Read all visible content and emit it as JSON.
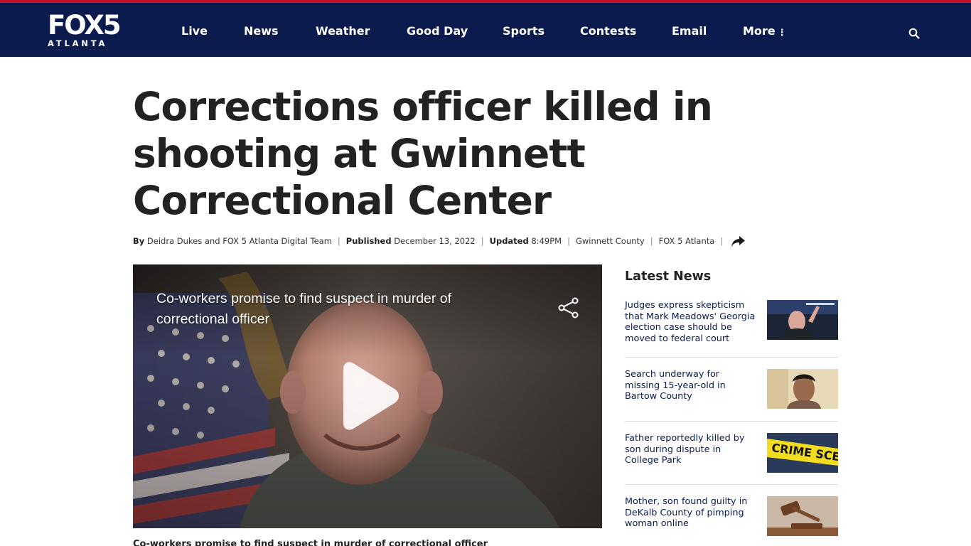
{
  "brand": {
    "logo_main": "FOX5",
    "logo_sub": "ATLANTA",
    "nav_bg": "#0b1b4d",
    "accent": "#c8102e"
  },
  "nav": {
    "items": [
      "Live",
      "News",
      "Weather",
      "Good Day",
      "Sports",
      "Contests",
      "Email",
      "More"
    ],
    "more_icon": "⋮"
  },
  "article": {
    "headline_lines": [
      "Corrections officer killed in",
      "shooting at Gwinnett",
      "Correctional Center"
    ],
    "byline_prefix": "By",
    "author": "Deidra Dukes",
    "and": "and",
    "team": "FOX 5 Atlanta Digital Team",
    "published_label": "Published",
    "published_date": "December 13, 2022",
    "updated_label": "Updated",
    "updated_time": "8:49PM",
    "tag_1": "Gwinnett County",
    "tag_2": "FOX 5 Atlanta",
    "sep": "|"
  },
  "video": {
    "title": "Co-workers promise to find suspect in murder of correctional officer",
    "caption": "Co-workers promise to find suspect in murder of correctional officer"
  },
  "sidebar": {
    "heading": "Latest News",
    "items": [
      {
        "title": "Judges express skepticism that Mark Meadows' Georgia election case should be moved to federal court",
        "thumb": "courtroom-speaker-photo"
      },
      {
        "title": "Search underway for missing 15-year-old in Bartow County",
        "thumb": "teen-portrait-photo"
      },
      {
        "title": "Father reportedly killed by son during dispute in College Park",
        "thumb": "crime-scene-tape-photo"
      },
      {
        "title": "Mother, son found guilty in DeKalb County of pimping woman online",
        "thumb": "gavel-photo"
      }
    ]
  }
}
